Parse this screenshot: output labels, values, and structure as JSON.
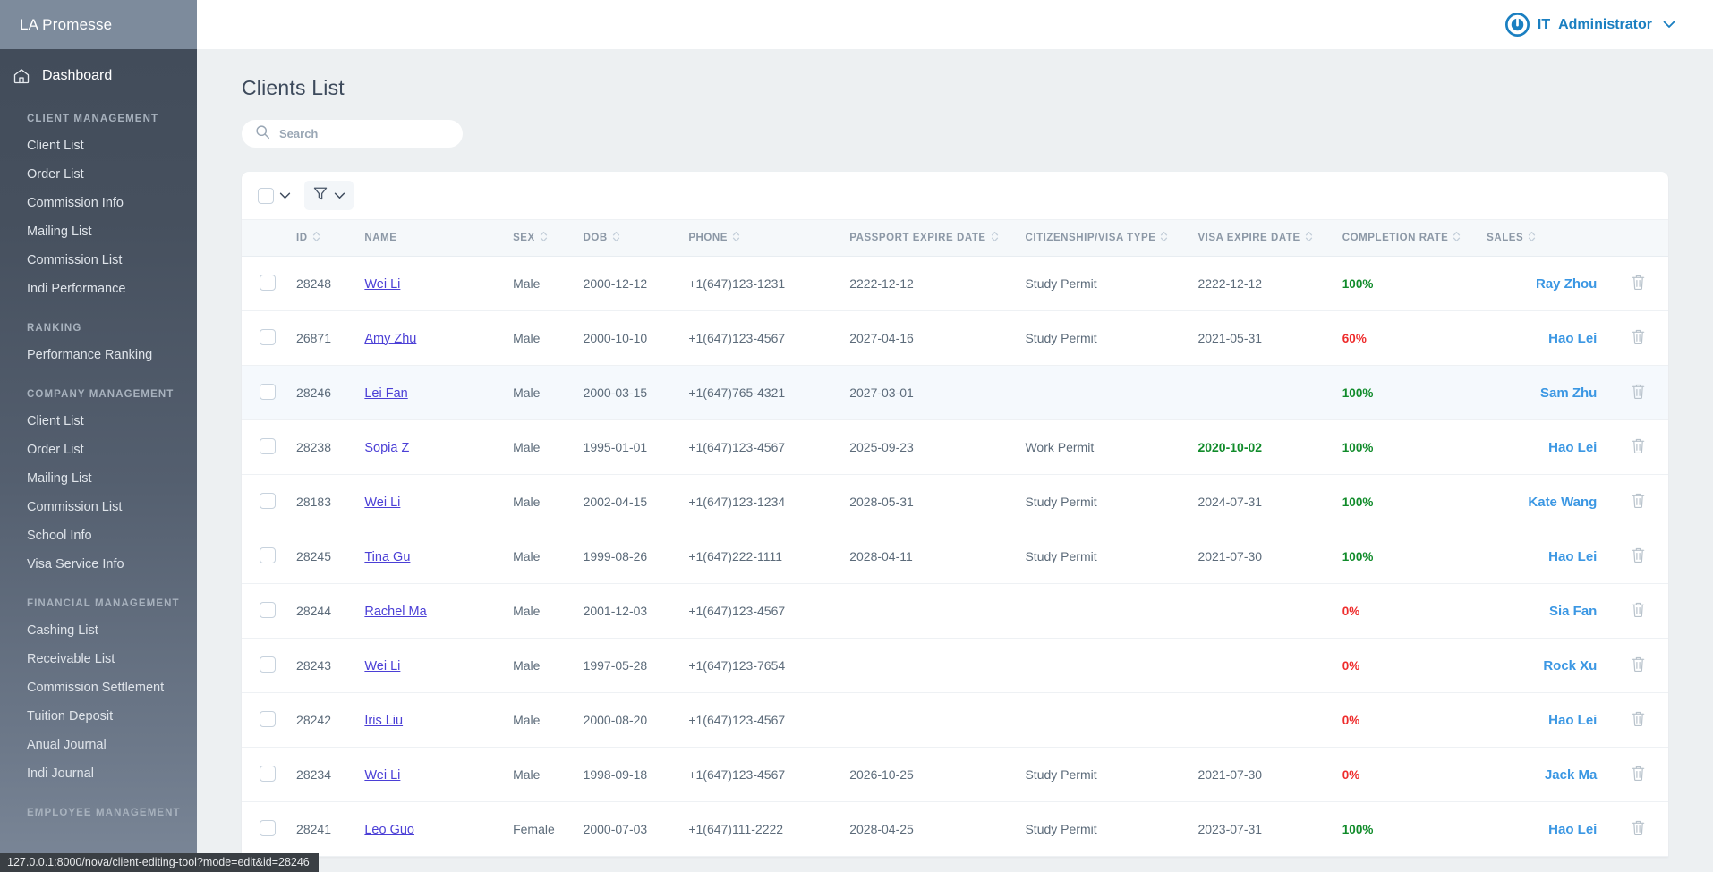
{
  "brand": {
    "name": "LA Promesse"
  },
  "topbar": {
    "user_prefix": "IT",
    "user_role": "Administrator",
    "chevron": "⌄"
  },
  "sidebar": {
    "dashboard_label": "Dashboard",
    "groups": [
      {
        "title": "CLIENT MANAGEMENT",
        "items": [
          {
            "label": "Client List"
          },
          {
            "label": "Order List"
          },
          {
            "label": "Commission Info"
          },
          {
            "label": "Mailing List"
          },
          {
            "label": "Commission List"
          },
          {
            "label": "Indi Performance"
          }
        ]
      },
      {
        "title": "RANKING",
        "items": [
          {
            "label": "Performance Ranking"
          }
        ]
      },
      {
        "title": "COMPANY MANAGEMENT",
        "items": [
          {
            "label": "Client List"
          },
          {
            "label": "Order List"
          },
          {
            "label": "Mailing List"
          },
          {
            "label": "Commission List"
          },
          {
            "label": "School Info"
          },
          {
            "label": "Visa Service Info"
          }
        ]
      },
      {
        "title": "FINANCIAL MANAGEMENT",
        "items": [
          {
            "label": "Cashing List"
          },
          {
            "label": "Receivable List"
          },
          {
            "label": "Commission Settlement"
          },
          {
            "label": "Tuition Deposit"
          },
          {
            "label": "Anual Journal"
          },
          {
            "label": "Indi Journal"
          }
        ]
      },
      {
        "title": "EMPLOYEE MANAGEMENT",
        "items": []
      }
    ]
  },
  "page": {
    "title": "Clients List",
    "search_placeholder": "Search",
    "search_value": ""
  },
  "table": {
    "columns": [
      {
        "key": "id",
        "label": "ID",
        "sortable": true
      },
      {
        "key": "name",
        "label": "NAME",
        "sortable": false
      },
      {
        "key": "sex",
        "label": "SEX",
        "sortable": true
      },
      {
        "key": "dob",
        "label": "DOB",
        "sortable": true
      },
      {
        "key": "phone",
        "label": "PHONE",
        "sortable": true
      },
      {
        "key": "pass",
        "label": "PASSPORT EXPIRE DATE",
        "sortable": true
      },
      {
        "key": "cit",
        "label": "CITIZENSHIP/VISA TYPE",
        "sortable": true
      },
      {
        "key": "visa",
        "label": "VISA EXPIRE DATE",
        "sortable": true
      },
      {
        "key": "rate",
        "label": "COMPLETION RATE",
        "sortable": true
      },
      {
        "key": "sales",
        "label": "SALES",
        "sortable": true
      }
    ],
    "rows": [
      {
        "id": "28248",
        "name": "Wei Li",
        "sex": "Male",
        "dob": "2000-12-12",
        "phone": "+1(647)123-1231",
        "passport_expire": "2222-12-12",
        "citizenship": "Study Permit",
        "visa_expire": "2222-12-12",
        "visa_expire_flag": false,
        "rate": "100%",
        "rate_state": "good",
        "sales": "Ray Zhou",
        "highlight": false
      },
      {
        "id": "26871",
        "name": "Amy Zhu",
        "sex": "Male",
        "dob": "2000-10-10",
        "phone": "+1(647)123-4567",
        "passport_expire": "2027-04-16",
        "citizenship": "Study Permit",
        "visa_expire": "2021-05-31",
        "visa_expire_flag": false,
        "rate": "60%",
        "rate_state": "bad",
        "sales": "Hao Lei",
        "highlight": false
      },
      {
        "id": "28246",
        "name": "Lei Fan",
        "sex": "Male",
        "dob": "2000-03-15",
        "phone": "+1(647)765-4321",
        "passport_expire": "2027-03-01",
        "citizenship": "",
        "visa_expire": "",
        "visa_expire_flag": false,
        "rate": "100%",
        "rate_state": "good",
        "sales": "Sam Zhu",
        "highlight": true
      },
      {
        "id": "28238",
        "name": "Sopia Z",
        "sex": "Male",
        "dob": "1995-01-01",
        "phone": "+1(647)123-4567",
        "passport_expire": "2025-09-23",
        "citizenship": "Work Permit",
        "visa_expire": "2020-10-02",
        "visa_expire_flag": true,
        "rate": "100%",
        "rate_state": "good",
        "sales": "Hao Lei",
        "highlight": false
      },
      {
        "id": "28183",
        "name": "Wei Li",
        "sex": "Male",
        "dob": "2002-04-15",
        "phone": "+1(647)123-1234",
        "passport_expire": "2028-05-31",
        "citizenship": "Study Permit",
        "visa_expire": "2024-07-31",
        "visa_expire_flag": false,
        "rate": "100%",
        "rate_state": "good",
        "sales": "Kate Wang",
        "highlight": false
      },
      {
        "id": "28245",
        "name": "Tina Gu",
        "sex": "Male",
        "dob": "1999-08-26",
        "phone": "+1(647)222-1111",
        "passport_expire": "2028-04-11",
        "citizenship": "Study Permit",
        "visa_expire": "2021-07-30",
        "visa_expire_flag": false,
        "rate": "100%",
        "rate_state": "good",
        "sales": "Hao Lei",
        "highlight": false
      },
      {
        "id": "28244",
        "name": "Rachel Ma",
        "sex": "Male",
        "dob": "2001-12-03",
        "phone": "+1(647)123-4567",
        "passport_expire": "",
        "citizenship": "",
        "visa_expire": "",
        "visa_expire_flag": false,
        "rate": "0%",
        "rate_state": "bad",
        "sales": "Sia Fan",
        "highlight": false
      },
      {
        "id": "28243",
        "name": "Wei Li",
        "sex": "Male",
        "dob": "1997-05-28",
        "phone": "+1(647)123-7654",
        "passport_expire": "",
        "citizenship": "",
        "visa_expire": "",
        "visa_expire_flag": false,
        "rate": "0%",
        "rate_state": "bad",
        "sales": "Rock Xu",
        "highlight": false
      },
      {
        "id": "28242",
        "name": "Iris Liu",
        "sex": "Male",
        "dob": "2000-08-20",
        "phone": "+1(647)123-4567",
        "passport_expire": "",
        "citizenship": "",
        "visa_expire": "",
        "visa_expire_flag": false,
        "rate": "0%",
        "rate_state": "bad",
        "sales": "Hao Lei",
        "highlight": false
      },
      {
        "id": "28234",
        "name": "Wei Li",
        "sex": "Male",
        "dob": "1998-09-18",
        "phone": "+1(647)123-4567",
        "passport_expire": "2026-10-25",
        "citizenship": "Study Permit",
        "visa_expire": "2021-07-30",
        "visa_expire_flag": false,
        "rate": "0%",
        "rate_state": "bad",
        "sales": "Jack Ma",
        "highlight": false
      },
      {
        "id": "28241",
        "name": "Leo Guo",
        "sex": "Female",
        "dob": "2000-07-03",
        "phone": "+1(647)111-2222",
        "passport_expire": "2028-04-25",
        "citizenship": "Study Permit",
        "visa_expire": "2023-07-31",
        "visa_expire_flag": false,
        "rate": "100%",
        "rate_state": "good",
        "sales": "Hao Lei",
        "highlight": false
      }
    ]
  },
  "statusbar": {
    "url": "127.0.0.1:8000/nova/client-editing-tool?mode=edit&id=28246"
  },
  "colors": {
    "sidebar_top": "#414b59",
    "sidebar_bottom": "#7b8798",
    "brand_bar": "#7d8b9c",
    "accent_blue": "#1a7fc1",
    "sales_blue": "#3b97e3",
    "link_purple": "#4b3fd6",
    "rate_good": "#108b2a",
    "rate_bad": "#ee2b2b",
    "page_bg": "#edf0f2",
    "row_highlight": "#f5f9fd"
  }
}
